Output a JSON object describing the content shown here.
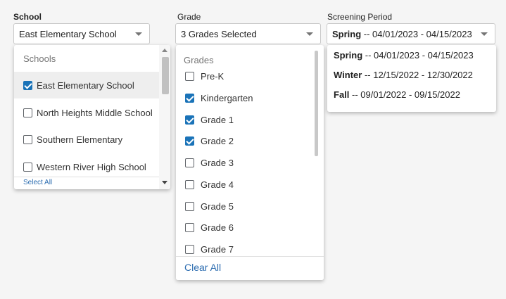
{
  "school": {
    "label": "School",
    "selected": "East Elementary School",
    "dropdown": {
      "header": "Schools",
      "items": [
        {
          "label": "East Elementary School",
          "checked": true
        },
        {
          "label": "North Heights Middle School",
          "checked": false
        },
        {
          "label": "Southern Elementary",
          "checked": false
        },
        {
          "label": "Western River High School",
          "checked": false
        }
      ],
      "select_all": "Select All"
    }
  },
  "grade": {
    "label": "Grade",
    "selected": "3 Grades Selected",
    "dropdown": {
      "header": "Grades",
      "items": [
        {
          "label": "Pre-K",
          "checked": false
        },
        {
          "label": "Kindergarten",
          "checked": true
        },
        {
          "label": "Grade 1",
          "checked": true
        },
        {
          "label": "Grade 2",
          "checked": true
        },
        {
          "label": "Grade 3",
          "checked": false
        },
        {
          "label": "Grade 4",
          "checked": false
        },
        {
          "label": "Grade 5",
          "checked": false
        },
        {
          "label": "Grade 6",
          "checked": false
        },
        {
          "label": "Grade 7",
          "checked": false
        }
      ],
      "clear_all": "Clear All"
    }
  },
  "screening_period": {
    "label": "Screening Period",
    "selected": {
      "season": "Spring",
      "range": " -- 04/01/2023 - 04/15/2023"
    },
    "options": [
      {
        "season": "Spring",
        "range": " -- 04/01/2023 - 04/15/2023"
      },
      {
        "season": "Winter",
        "range": " -- 12/15/2022 - 12/30/2022"
      },
      {
        "season": "Fall",
        "range": " -- 09/01/2022 - 09/15/2022"
      }
    ]
  },
  "colors": {
    "accent": "#1a73b8",
    "highlight": "#eeeeee",
    "link": "#2b6cb0"
  }
}
